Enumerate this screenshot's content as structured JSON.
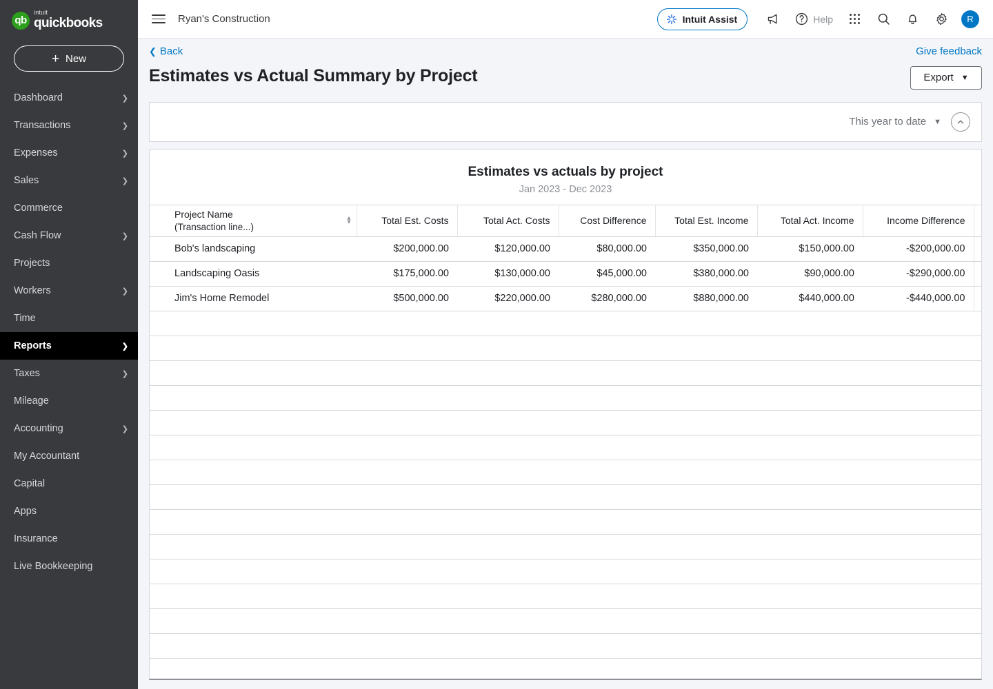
{
  "brand": {
    "intuit": "intuit",
    "name": "quickbooks",
    "mark": "qb"
  },
  "sidebar": {
    "new_button": {
      "label": "New",
      "icon": "plus-icon"
    },
    "items": [
      {
        "label": "Dashboard",
        "chevron": true,
        "active": false
      },
      {
        "label": "Transactions",
        "chevron": true,
        "active": false
      },
      {
        "label": "Expenses",
        "chevron": true,
        "active": false
      },
      {
        "label": "Sales",
        "chevron": true,
        "active": false
      },
      {
        "label": "Commerce",
        "chevron": false,
        "active": false
      },
      {
        "label": "Cash Flow",
        "chevron": true,
        "active": false
      },
      {
        "label": "Projects",
        "chevron": false,
        "active": false
      },
      {
        "label": "Workers",
        "chevron": true,
        "active": false
      },
      {
        "label": "Time",
        "chevron": false,
        "active": false
      },
      {
        "label": "Reports",
        "chevron": true,
        "active": true
      },
      {
        "label": "Taxes",
        "chevron": true,
        "active": false
      },
      {
        "label": "Mileage",
        "chevron": false,
        "active": false
      },
      {
        "label": "Accounting",
        "chevron": true,
        "active": false
      },
      {
        "label": "My Accountant",
        "chevron": false,
        "active": false
      },
      {
        "label": "Capital",
        "chevron": false,
        "active": false
      },
      {
        "label": "Apps",
        "chevron": false,
        "active": false
      },
      {
        "label": "Insurance",
        "chevron": false,
        "active": false
      },
      {
        "label": "Live Bookkeeping",
        "chevron": false,
        "active": false
      }
    ]
  },
  "topbar": {
    "menu_icon": "hamburger-icon",
    "company": "Ryan's Construction",
    "assist_label": "Intuit Assist",
    "assist_icon": "sparkle-icon",
    "announce_icon": "megaphone-icon",
    "help_label": "Help",
    "help_icon": "question-circle-icon",
    "apps_icon": "grid-icon",
    "search_icon": "search-icon",
    "notifications_icon": "bell-icon",
    "settings_icon": "gear-icon",
    "avatar_initial": "R"
  },
  "header": {
    "back_label": "Back",
    "feedback_label": "Give feedback",
    "page_title": "Estimates vs Actual Summary by Project",
    "export_label": "Export"
  },
  "filter_bar": {
    "date_range": "This year to date",
    "collapse_icon": "chevron-up-circle-icon"
  },
  "chart_data": {
    "type": "table",
    "title": "Estimates vs actuals by project",
    "subtitle": "Jan 2023 - Dec 2023",
    "columns": [
      "Project Name",
      "Total Est. Costs",
      "Total Act. Costs",
      "Cost Difference",
      "Total Est. Income",
      "Total Act. Income",
      "Income Difference"
    ],
    "column_subtext": {
      "Project Name": "(Transaction line...)"
    },
    "rows": [
      {
        "name": "Bob's landscaping",
        "total_est_costs": "$200,000.00",
        "total_act_costs": "$120,000.00",
        "cost_difference": "$80,000.00",
        "total_est_income": "$350,000.00",
        "total_act_income": "$150,000.00",
        "income_difference": "-$200,000.00"
      },
      {
        "name": "Landscaping Oasis",
        "total_est_costs": "$175,000.00",
        "total_act_costs": "$130,000.00",
        "cost_difference": "$45,000.00",
        "total_est_income": "$380,000.00",
        "total_act_income": "$90,000.00",
        "income_difference": "-$290,000.00"
      },
      {
        "name": "Jim's Home Remodel",
        "total_est_costs": "$500,000.00",
        "total_act_costs": "$220,000.00",
        "cost_difference": "$280,000.00",
        "total_est_income": "$880,000.00",
        "total_act_income": "$440,000.00",
        "income_difference": "-$440,000.00"
      }
    ],
    "empty_row_count": 15
  },
  "colors": {
    "brand_green": "#2ca01c",
    "link_blue": "#0077c5",
    "sidebar_bg": "#393a3d",
    "active_nav_bg": "#000000",
    "page_bg": "#f4f5f8",
    "avatar_bg": "#0077c5"
  }
}
